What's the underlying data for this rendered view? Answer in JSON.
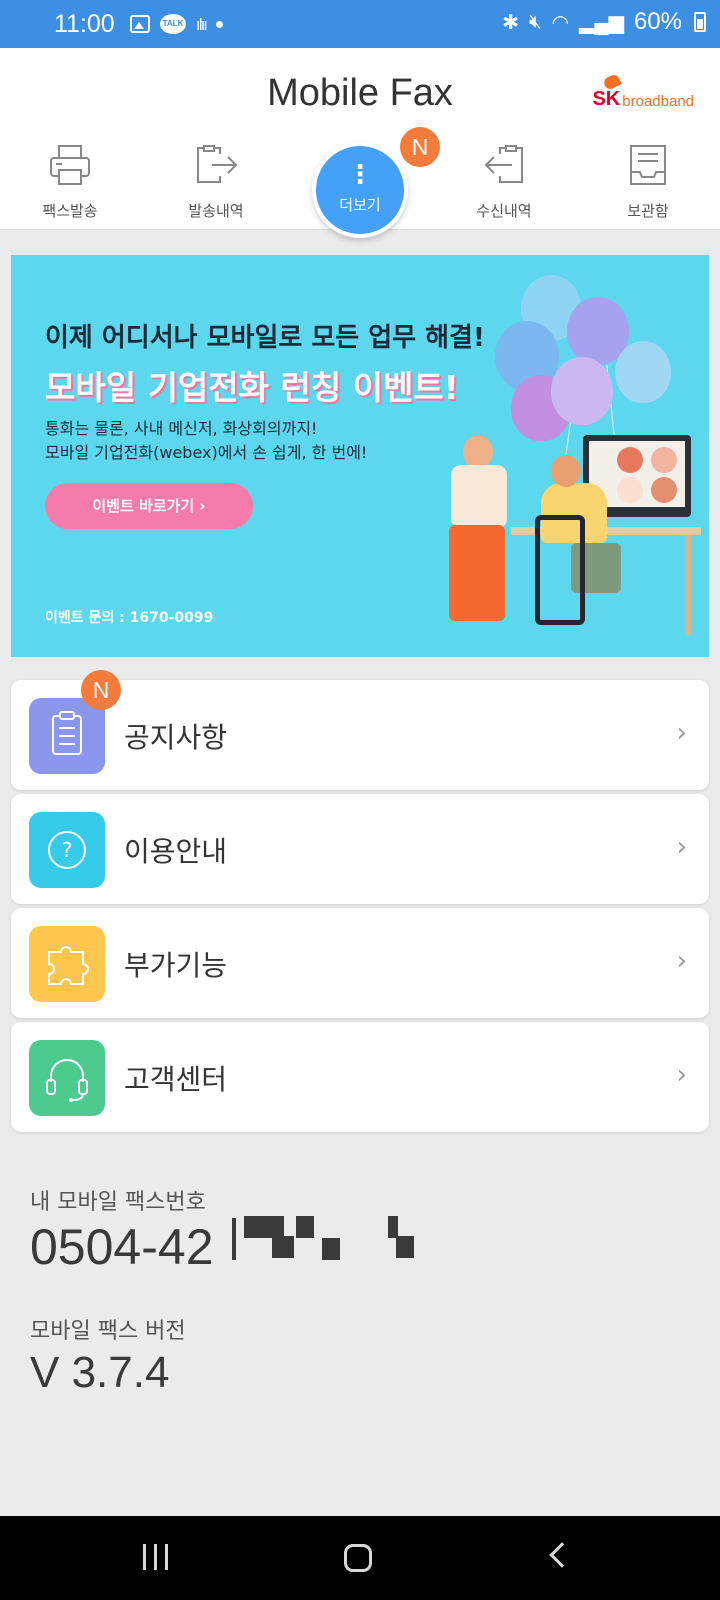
{
  "status_bar": {
    "time": "11:00",
    "talk_label": "TALK",
    "battery": "60%",
    "icons": [
      "image-icon",
      "kakaotalk-icon",
      "voice-wave-icon",
      "dot-icon",
      "bluetooth-icon",
      "mute-icon",
      "wifi-icon",
      "signal-icon",
      "battery-icon"
    ]
  },
  "header": {
    "title": "Mobile Fax",
    "brand_sk": "SK",
    "brand_name": "broadband"
  },
  "tabs": {
    "fax_send": "팩스발송",
    "sent_history": "발송내역",
    "more": "더보기",
    "received_history": "수신내역",
    "storage": "보관함",
    "more_badge": "N"
  },
  "banner": {
    "headline": "이제 어디서나 모바일로 모든 업무 해결!",
    "title": "모바일 기업전화 런칭 이벤트!",
    "desc_line1": "통화는 물론, 사내 메신저, 화상회의까지!",
    "desc_line2": "모바일 기업전화(webex)에서 손 쉽게, 한 번에!",
    "button": "이벤트 바로가기  ›",
    "contact": "이벤트 문의 : 1670-0099"
  },
  "menu": [
    {
      "label": "공지사항",
      "icon": "clipboard-icon",
      "color": "#8b97ec",
      "badge": "N"
    },
    {
      "label": "이용안내",
      "icon": "question-icon",
      "color": "#35cbe9"
    },
    {
      "label": "부가기능",
      "icon": "puzzle-icon",
      "color": "#ffc64d"
    },
    {
      "label": "고객센터",
      "icon": "headset-icon",
      "color": "#4dcb8e"
    }
  ],
  "chevron": "›",
  "info": {
    "fax_number_label": "내 모바일 팩스번호",
    "fax_number": "0504-42",
    "version_label": "모바일 팩스 버전",
    "version": "V 3.7.4"
  },
  "colors": {
    "status_bar": "#3d8fe4",
    "accent_blue": "#44a1f7",
    "badge_orange": "#f37b3b",
    "banner_bg": "#5dd7ed",
    "banner_button": "#f57bab"
  }
}
